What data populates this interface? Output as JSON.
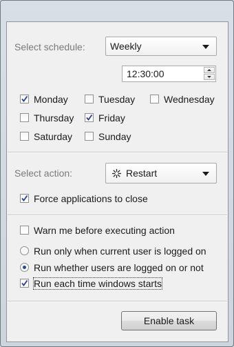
{
  "schedule": {
    "label": "Select schedule:",
    "value": "Weekly",
    "time": "12:30:00"
  },
  "days": [
    {
      "label": "Monday",
      "checked": true
    },
    {
      "label": "Tuesday",
      "checked": false
    },
    {
      "label": "Wednesday",
      "checked": false
    },
    {
      "label": "Thursday",
      "checked": false
    },
    {
      "label": "Friday",
      "checked": true
    },
    {
      "label": "Saturday",
      "checked": false
    },
    {
      "label": "Sunday",
      "checked": false
    }
  ],
  "action": {
    "label": "Select action:",
    "value": "Restart",
    "icon": "restart-icon",
    "force_close": {
      "label": "Force applications to close",
      "checked": true
    }
  },
  "options": {
    "warn": {
      "label": "Warn me before executing action",
      "checked": false
    },
    "run_logged_on": {
      "label": "Run only when current user is logged on",
      "selected": false
    },
    "run_whether": {
      "label": "Run whether users are logged on or not",
      "selected": true
    },
    "run_each_start": {
      "label": "Run each time windows starts",
      "checked": true
    }
  },
  "footer": {
    "enable_button": "Enable task"
  }
}
